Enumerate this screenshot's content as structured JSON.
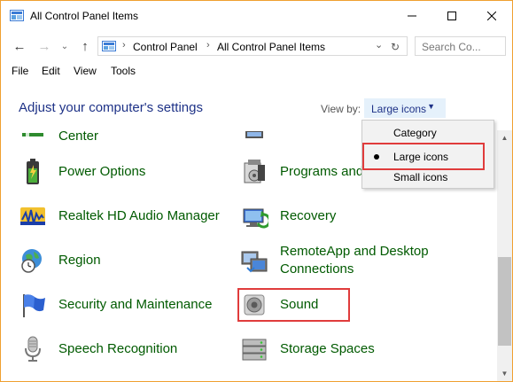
{
  "window": {
    "title": "All Control Panel Items"
  },
  "address": {
    "segments": [
      "Control Panel",
      "All Control Panel Items"
    ],
    "search_placeholder": "Search Co..."
  },
  "menu": [
    "File",
    "Edit",
    "View",
    "Tools"
  ],
  "content": {
    "heading": "Adjust your computer's settings",
    "view_by_label": "View by:",
    "view_by_value": "Large icons"
  },
  "view_menu": {
    "options": [
      "Category",
      "Large icons",
      "Small icons"
    ],
    "selected": "Large icons"
  },
  "items_left": [
    "Center",
    "Power Options",
    "Realtek HD Audio Manager",
    "Region",
    "Security and Maintenance",
    "Speech Recognition"
  ],
  "items_right": [
    "Programs and",
    "Recovery",
    "RemoteApp and Desktop Connections",
    "Sound",
    "Storage Spaces"
  ],
  "colors": {
    "heading": "#1e3287",
    "item_text": "#005a00",
    "highlight": "#e03c3c",
    "window_border": "#f0a030"
  }
}
